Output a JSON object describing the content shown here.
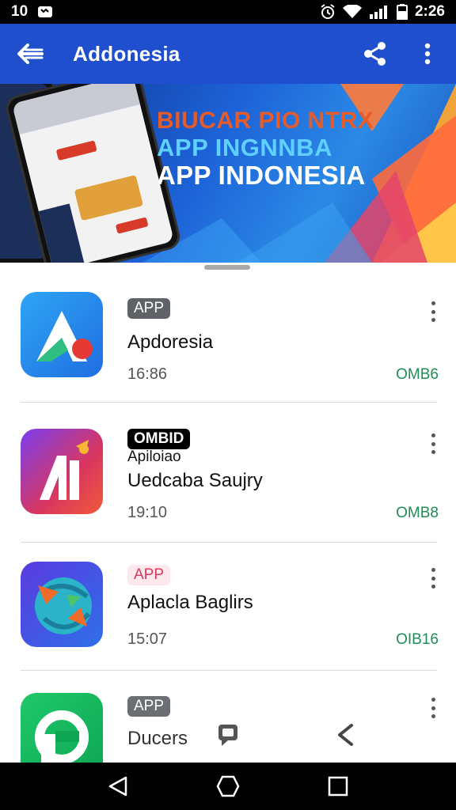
{
  "status_bar": {
    "left_text": "10",
    "time": "2:26"
  },
  "app_bar": {
    "title": "Addonesia",
    "icons": [
      "arrow-back-icon",
      "share-icon",
      "more-vert-icon"
    ],
    "color": "#1f4fcf"
  },
  "banner": {
    "line1": "BIUCAR PIO NTRX",
    "line2": "APP INGNNBA",
    "line3": "APP INDONESIA"
  },
  "items": [
    {
      "tag": "APP",
      "subtitle": "",
      "name": "Apdoresia",
      "time": "16:86",
      "size": "OMB6"
    },
    {
      "tag": "OMBID",
      "subtitle": "Apiloiao",
      "name": "Uedcaba Saujry",
      "time": "19:10",
      "size": "OMB8"
    },
    {
      "tag": "APP",
      "subtitle": "",
      "name": "Aplacla Baglirs",
      "time": "15:07",
      "size": "OIB16"
    },
    {
      "tag": "APP",
      "subtitle": "",
      "name": "Ducers",
      "time": "",
      "size": ""
    }
  ]
}
